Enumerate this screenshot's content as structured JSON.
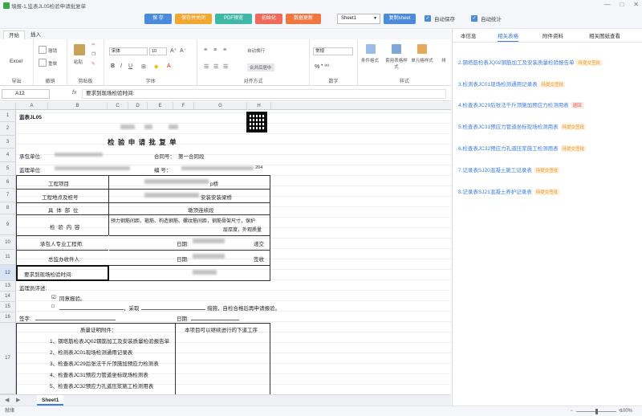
{
  "window": {
    "title": "填报-1.监表JL05检验申请批复单",
    "minimize": "—",
    "maximize": "□",
    "close": "✕"
  },
  "toolbar": {
    "save": "保 存",
    "save_close": "保存并关闭",
    "pdf_preview": "PDF预览",
    "initialize": "初始化",
    "data_update": "数据更新",
    "sheet_select": "Sheet1",
    "copy_sheet": "复制sheet",
    "autosave": "自动保存",
    "autostat": "自动统计"
  },
  "ribbon": {
    "tabs": [
      "开始",
      "插入"
    ],
    "groups": {
      "export": "导出",
      "undo": "撤销",
      "clipboard": "剪贴板",
      "font": "字体",
      "align": "对齐方式",
      "number": "数字",
      "style": "样式"
    },
    "export_label": "Excel",
    "undo_label": "撤销",
    "redo_label": "重做",
    "paste": "粘贴",
    "cut": "剪切",
    "copy": "复制",
    "format_painter": "格式刷",
    "font_name": "宋体",
    "font_size": "10",
    "number_format": "常规",
    "wrap": "自动换行",
    "merge": "合并后居中",
    "cond_format": "条件格式",
    "table_format": "套用表格样式",
    "cell_style": "单元格样式",
    "sort": "排"
  },
  "formula": {
    "cell_ref": "A12",
    "fx": "fx",
    "content": "要求到现场检验时间:"
  },
  "grid": {
    "columns": [
      "A",
      "B",
      "C",
      "D",
      "E",
      "F",
      "G",
      "H"
    ],
    "rows": [
      "1",
      "2",
      "3",
      "4",
      "5",
      "6",
      "7",
      "8",
      "9",
      "10",
      "11",
      "12",
      "13",
      "14",
      "15",
      "16",
      "17"
    ],
    "doc": {
      "code": "监表JL05",
      "title": "检 验 申 请 批 复 单",
      "contractor": "承包单位:",
      "contract_no": "合同号：",
      "contract_no_val": "第一合同段",
      "supervisor": "监理单位:",
      "number": "编    号：",
      "num_suffix": "204",
      "project": "工程项目",
      "project_val": "p桥",
      "location": "工程地点及桩号",
      "location_val": "安装安装梁桥",
      "part": "具 体 部 位",
      "part_val": "墩顶连续段",
      "content": "检 验 内 容",
      "content_val1": "预力钢筋间距、箍筋、构造钢筋、螺纹筋间距，钢筋骨架尺寸，保护",
      "content_val2": "层厚度，外观质量",
      "engineer": "承包人专业工程师:",
      "date": "日期:",
      "submit": "递交",
      "receiver": "总监办收件人:",
      "sign": "签收",
      "req_time": "要求到现场检验时间:",
      "opinion": "监理员评述:",
      "agree": "同意报验。",
      "cb1": "☑",
      "cb2": "☐",
      "other": "□",
      "takes": "，采取",
      "rework": "措施，自检合格后再申请报验。",
      "signature": "签字:",
      "quality": "质量证明附件：",
      "next": "本项目可以继续进行的下道工序",
      "att1": "1、钢塔筋检表JQ02钢筋加工及安装质量检验报告单",
      "att2": "2、检测表JC01现场检测通用记录表",
      "att3": "3、检查表JC29后张法千斤顶施加预应力检测表",
      "att4": "4、检查表JC31预应力管道坐标现场检测表",
      "att5": "5、检查表JC32预应力孔道压浆施工检测用表"
    }
  },
  "sheettab": {
    "name": "Sheet1",
    "nav_first": "◀",
    "nav_last": "▶"
  },
  "status": {
    "text": "就绪",
    "zoom": "100%",
    "minus": "−",
    "plus": "+"
  },
  "rightpane": {
    "tabs": [
      "本信息",
      "相关表格",
      "附件资料",
      "相关图纸查看"
    ],
    "items": [
      {
        "text": "2.钢塔筋检表JQ02钢筋加工及安装质量检验报告单",
        "badge": "待提交签批",
        "type": "p"
      },
      {
        "text": "3.检测表JC01现场检测通用记录表",
        "badge": "待提交签批",
        "type": "p"
      },
      {
        "text": "4.检查表JC29后张法千斤顶施加预应力检测用表",
        "badge": "退回",
        "type": "r"
      },
      {
        "text": "5.检查表JC31预应力管道坐标现场检测用表",
        "badge": "待提交签批",
        "type": "p"
      },
      {
        "text": "6.检查表JC32预应力孔道压浆施工检测用表",
        "badge": "待提交签批",
        "type": "p"
      },
      {
        "text": "7.记录表SJ20混凝土施工记录表",
        "badge": "待提交签批",
        "type": "p"
      },
      {
        "text": "8.记录表SJ21混凝土养护记录表",
        "badge": "待提交签批",
        "type": "p"
      }
    ]
  },
  "colors": {
    "blue": "#4a8bdc",
    "orange": "#f0a830",
    "teal": "#3fb8a8",
    "red": "#ef6a5a",
    "deep_orange": "#f07840",
    "link": "#3c7be0"
  }
}
